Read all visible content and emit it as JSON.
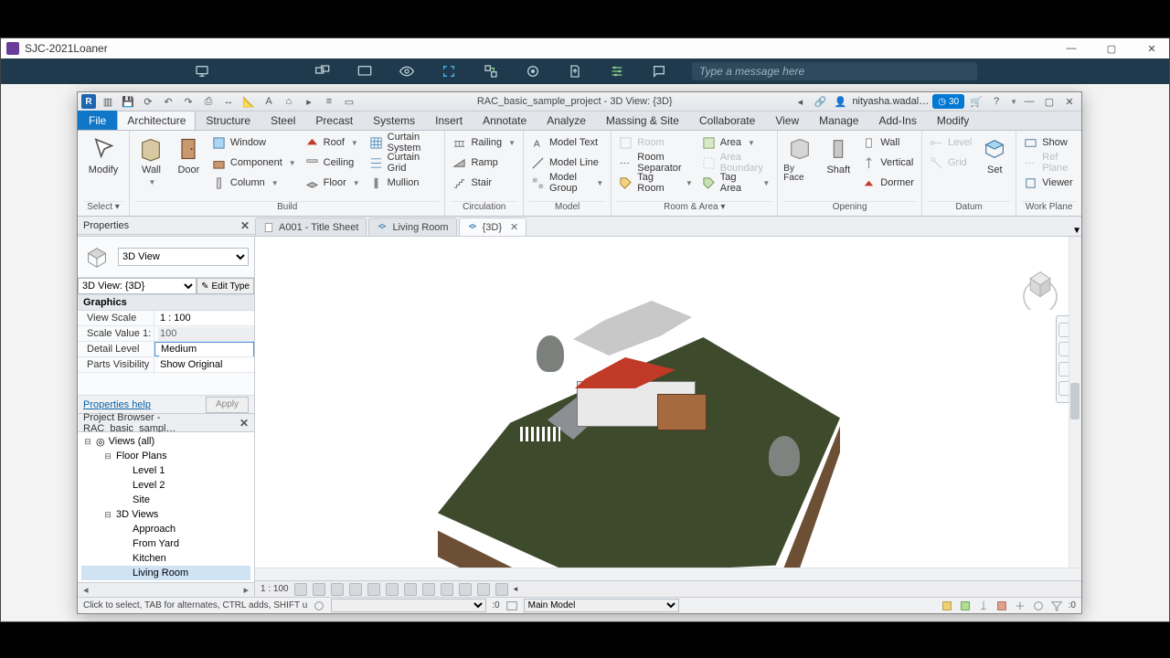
{
  "outer_window": {
    "title": "SJC-2021Loaner",
    "controls": {
      "min": "—",
      "max": "▢",
      "close": "✕"
    }
  },
  "meetbar": {
    "msg_placeholder": "Type a message here"
  },
  "qat": {
    "doc_title": "RAC_basic_sample_project - 3D View: {3D}",
    "user": "nityasha.wadal…",
    "timer": "30"
  },
  "ribbon": {
    "file": "File",
    "tabs": [
      "Architecture",
      "Structure",
      "Steel",
      "Precast",
      "Systems",
      "Insert",
      "Annotate",
      "Analyze",
      "Massing & Site",
      "Collaborate",
      "View",
      "Manage",
      "Add-Ins",
      "Modify"
    ],
    "active_tab": "Architecture",
    "groups": {
      "select": {
        "title": "Select ▾",
        "modify": "Modify"
      },
      "build": {
        "title": "Build",
        "wall": "Wall",
        "door": "Door",
        "col1": [
          "Window",
          "Component",
          "Column"
        ],
        "col2": [
          "Roof",
          "Ceiling",
          "Floor"
        ],
        "col3": [
          "Curtain System",
          "Curtain Grid",
          "Mullion"
        ]
      },
      "circ": {
        "title": "Circulation",
        "items": [
          "Railing",
          "Ramp",
          "Stair"
        ]
      },
      "model": {
        "title": "Model",
        "items": [
          "Model Text",
          "Model Line",
          "Model Group"
        ]
      },
      "room": {
        "title": "Room & Area ▾",
        "col1": [
          "Room",
          "Room Separator",
          "Tag Room"
        ],
        "col2": [
          "Area",
          "Area Boundary",
          "Tag Area"
        ]
      },
      "open": {
        "title": "Opening",
        "byface": "By Face",
        "shaft": "Shaft",
        "col": [
          "Wall",
          "Vertical",
          "Dormer"
        ]
      },
      "datum": {
        "title": "Datum",
        "items": [
          "Level",
          "Grid"
        ],
        "set": "Set"
      },
      "wp": {
        "title": "Work Plane",
        "items": [
          "Show",
          "Ref Plane",
          "Viewer"
        ]
      }
    }
  },
  "view_tabs": [
    {
      "label": "A001 - Title Sheet",
      "active": false,
      "closable": false
    },
    {
      "label": "Living Room",
      "active": false,
      "closable": false
    },
    {
      "label": "{3D}",
      "active": true,
      "closable": true
    }
  ],
  "properties": {
    "panel_title": "Properties",
    "type_name": "3D View",
    "instance": "3D View: {3D}",
    "edit_type": "Edit Type",
    "category": "Graphics",
    "rows": [
      {
        "label": "View Scale",
        "value": "1 : 100",
        "ro": false
      },
      {
        "label": "Scale Value  1:",
        "value": "100",
        "ro": true
      },
      {
        "label": "Detail Level",
        "value": "Medium",
        "ro": false,
        "sel": true
      },
      {
        "label": "Parts Visibility",
        "value": "Show Original",
        "ro": false
      }
    ],
    "help": "Properties help",
    "apply": "Apply"
  },
  "browser": {
    "panel_title": "Project Browser - RAC_basic_sampl…",
    "root": "Views (all)",
    "nodes": [
      {
        "indent": 1,
        "tw": "⊟",
        "label": "Floor Plans"
      },
      {
        "indent": 2,
        "tw": "",
        "label": "Level 1"
      },
      {
        "indent": 2,
        "tw": "",
        "label": "Level 2"
      },
      {
        "indent": 2,
        "tw": "",
        "label": "Site"
      },
      {
        "indent": 1,
        "tw": "⊟",
        "label": "3D Views"
      },
      {
        "indent": 2,
        "tw": "",
        "label": "Approach"
      },
      {
        "indent": 2,
        "tw": "",
        "label": "From Yard"
      },
      {
        "indent": 2,
        "tw": "",
        "label": "Kitchen"
      },
      {
        "indent": 2,
        "tw": "",
        "label": "Living Room",
        "sel": true
      }
    ]
  },
  "view_control": {
    "scale": "1 : 100"
  },
  "status": {
    "hint": "Click to select, TAB for alternates, CTRL adds, SHIFT u",
    "sel": ":0",
    "main_model": "Main Model",
    "filter": ":0"
  }
}
